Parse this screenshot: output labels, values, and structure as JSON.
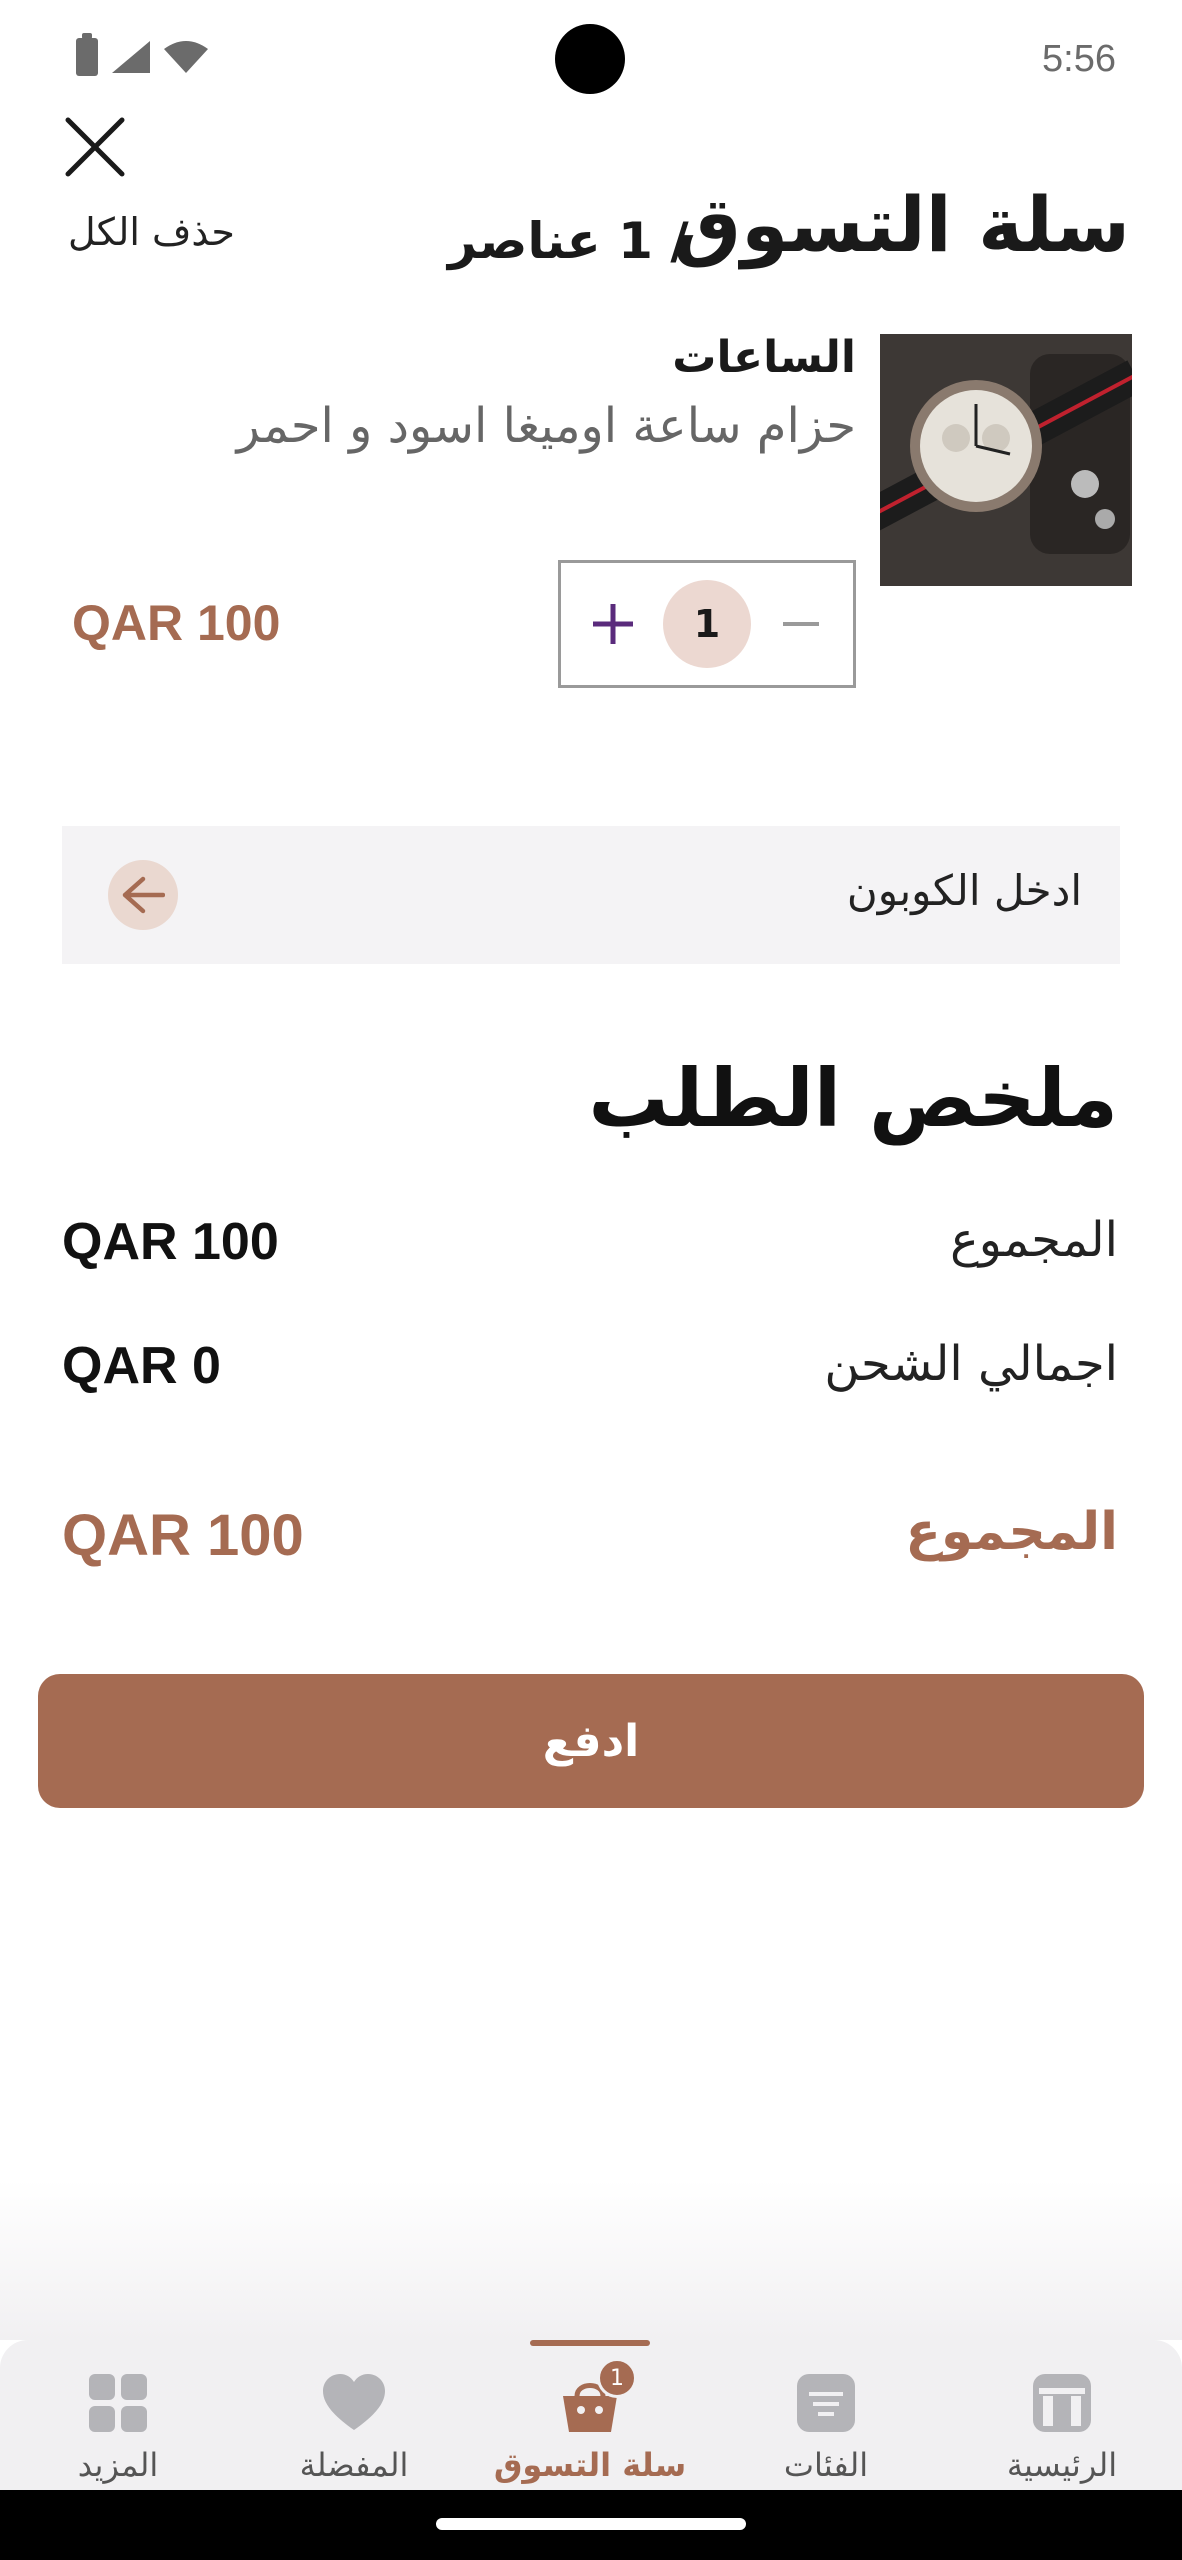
{
  "status": {
    "time": "5:56"
  },
  "header": {
    "title": "سلة التسوق",
    "item_count": "/ 1 عناصر",
    "delete_all": "حذف الكل"
  },
  "cart_item": {
    "category": "الساعات",
    "name": "حزام ساعة اوميغا اسود و احمر",
    "price": "QAR 100",
    "quantity": "1"
  },
  "coupon": {
    "placeholder": "ادخل الكوبون"
  },
  "summary": {
    "title": "ملخص الطلب",
    "subtotal_label": "المجموع",
    "subtotal_value": "QAR 100",
    "shipping_label": "اجمالي الشحن",
    "shipping_value": "QAR 0",
    "total_label": "المجموع",
    "total_value": "QAR 100"
  },
  "pay_button": "ادفع",
  "colors": {
    "accent": "#a56b52",
    "quantity_plus": "#5a2b7c",
    "coupon_bg": "#f4f3f5"
  },
  "nav": {
    "items": [
      {
        "label": "المزيد",
        "icon": "grid-icon"
      },
      {
        "label": "المفضلة",
        "icon": "heart-icon"
      },
      {
        "label": "سلة التسوق",
        "icon": "basket-icon",
        "badge": "1",
        "active": true
      },
      {
        "label": "الفئات",
        "icon": "list-icon"
      },
      {
        "label": "الرئيسية",
        "icon": "home-icon"
      }
    ]
  }
}
